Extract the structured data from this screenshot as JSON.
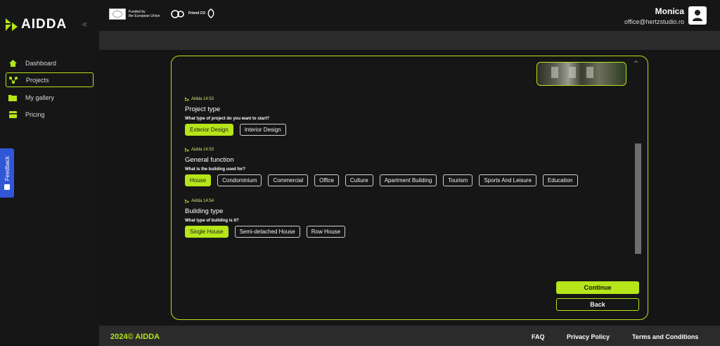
{
  "header": {
    "brand": "AIDDA",
    "collapse_glyph": "«",
    "eu_line1": "Funded by",
    "eu_line2": "the European Union",
    "friend_label": "Friend CO",
    "user_name": "Monica",
    "user_email": "office@hertzstudio.ro"
  },
  "sidebar": {
    "items": [
      {
        "label": "Dashboard",
        "icon": "home-icon"
      },
      {
        "label": "Projects",
        "icon": "projects-icon",
        "active": true
      },
      {
        "label": "My gallery",
        "icon": "folder-icon"
      },
      {
        "label": "Pricing",
        "icon": "pricing-icon"
      }
    ],
    "feedback_label": "Feedback"
  },
  "chat": {
    "sections": [
      {
        "meta": "Aidda 14:53",
        "title": "Project type",
        "question": "What type of project do you want to start?",
        "options": [
          "Exterior Design",
          "Interior Design"
        ],
        "selected": 0
      },
      {
        "meta": "Aidda 14:53",
        "title": "General function",
        "question": "What is the building used for?",
        "options": [
          "House",
          "Condominium",
          "Commercial",
          "Office",
          "Culture",
          "Apartment Building",
          "Tourism",
          "Sports And Leisure",
          "Education"
        ],
        "selected": 0
      },
      {
        "meta": "Aidda 14:54",
        "title": "Building type",
        "question": "What type of building is it?",
        "options": [
          "Single House",
          "Semi-detached House",
          "Row House"
        ],
        "selected": 0
      }
    ],
    "continue_label": "Continue",
    "back_label": "Back",
    "scroll_up_glyph": "^"
  },
  "footer": {
    "copyright": "2024© AIDDA",
    "faq": "FAQ",
    "privacy": "Privacy Policy",
    "terms": "Terms and Conditions"
  },
  "colors": {
    "accent": "#b6e51a",
    "background": "#151515",
    "panel": "#2b2b2b",
    "feedback": "#3157d6"
  }
}
